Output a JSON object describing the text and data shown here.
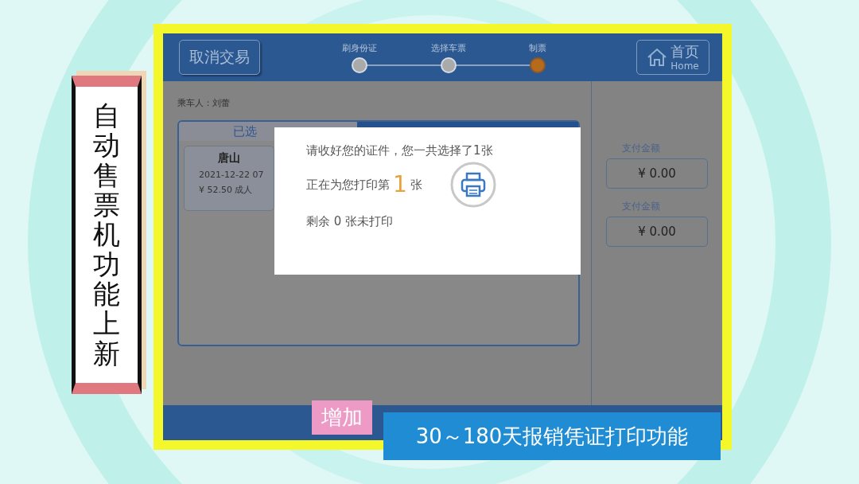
{
  "banner": {
    "title": "自动售票机功能上新"
  },
  "header": {
    "cancel_button": "取消交易",
    "home_button": {
      "label": "首页",
      "sublabel": "Home"
    },
    "steps": [
      {
        "label": "刷身份证",
        "selected": false
      },
      {
        "label": "选择车票",
        "selected": false
      },
      {
        "label": "制票",
        "selected": true
      }
    ]
  },
  "passenger": "乘车人：刘蕾",
  "tab": {
    "label": "已选",
    "selected": true
  },
  "ticket": {
    "station": "唐山",
    "datetime": "2021-12-22 07",
    "price": "¥ 52.50 成人"
  },
  "payment": [
    {
      "label": "支付金额",
      "amount": "¥ 0.00"
    },
    {
      "label": "支付金额",
      "amount": "¥ 0.00"
    }
  ],
  "dialog": {
    "line1": "请收好您的证件，您一共选择了1张",
    "line2_before": "正在为您打印第",
    "current": "1",
    "line2_after": "张",
    "remaining": "剩余 0 张未打印"
  },
  "caption": {
    "tag": "增加",
    "text": "30～180天报销凭证打印功能"
  }
}
